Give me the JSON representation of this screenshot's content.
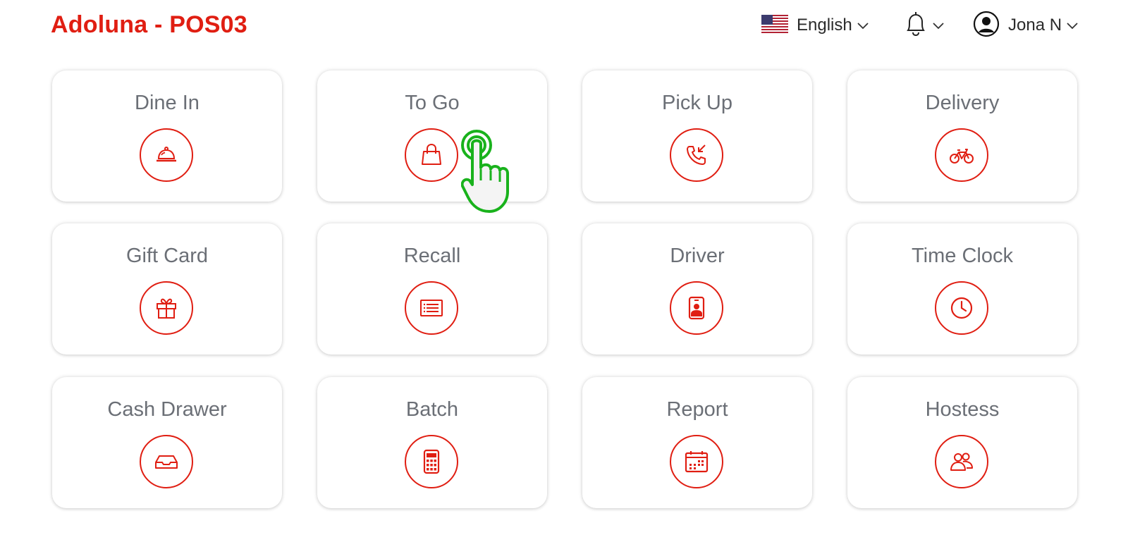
{
  "header": {
    "title": "Adoluna - POS03",
    "language": "English",
    "user": "Jona N"
  },
  "colors": {
    "accent": "#e01e12",
    "label": "#6b6f76",
    "cursor": "#19b21c"
  },
  "tiles": [
    {
      "label": "Dine In",
      "icon": "cloche-icon"
    },
    {
      "label": "To Go",
      "icon": "shopping-bag-icon"
    },
    {
      "label": "Pick Up",
      "icon": "incoming-call-icon"
    },
    {
      "label": "Delivery",
      "icon": "bicycle-icon"
    },
    {
      "label": "Gift Card",
      "icon": "gift-icon"
    },
    {
      "label": "Recall",
      "icon": "receipt-list-icon"
    },
    {
      "label": "Driver",
      "icon": "driver-badge-icon"
    },
    {
      "label": "Time Clock",
      "icon": "clock-icon"
    },
    {
      "label": "Cash Drawer",
      "icon": "drawer-icon"
    },
    {
      "label": "Batch",
      "icon": "calculator-icon"
    },
    {
      "label": "Report",
      "icon": "calendar-icon"
    },
    {
      "label": "Hostess",
      "icon": "users-icon"
    }
  ]
}
